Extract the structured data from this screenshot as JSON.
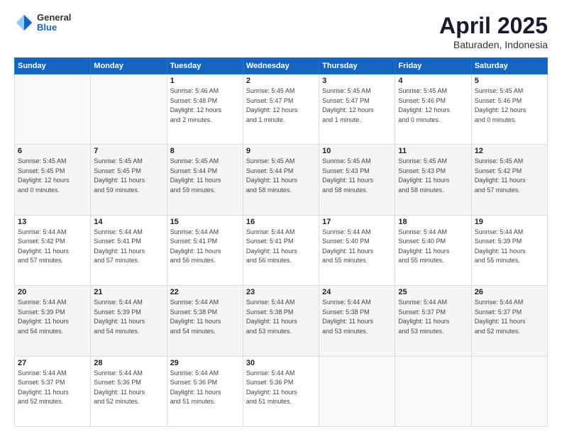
{
  "header": {
    "logo": {
      "line1": "General",
      "line2": "Blue"
    },
    "title": "April 2025",
    "location": "Baturaden, Indonesia"
  },
  "days_of_week": [
    "Sunday",
    "Monday",
    "Tuesday",
    "Wednesday",
    "Thursday",
    "Friday",
    "Saturday"
  ],
  "weeks": [
    [
      {
        "day": "",
        "info": ""
      },
      {
        "day": "",
        "info": ""
      },
      {
        "day": "1",
        "info": "Sunrise: 5:46 AM\nSunset: 5:48 PM\nDaylight: 12 hours\nand 2 minutes."
      },
      {
        "day": "2",
        "info": "Sunrise: 5:45 AM\nSunset: 5:47 PM\nDaylight: 12 hours\nand 1 minute."
      },
      {
        "day": "3",
        "info": "Sunrise: 5:45 AM\nSunset: 5:47 PM\nDaylight: 12 hours\nand 1 minute."
      },
      {
        "day": "4",
        "info": "Sunrise: 5:45 AM\nSunset: 5:46 PM\nDaylight: 12 hours\nand 0 minutes."
      },
      {
        "day": "5",
        "info": "Sunrise: 5:45 AM\nSunset: 5:46 PM\nDaylight: 12 hours\nand 0 minutes."
      }
    ],
    [
      {
        "day": "6",
        "info": "Sunrise: 5:45 AM\nSunset: 5:45 PM\nDaylight: 12 hours\nand 0 minutes."
      },
      {
        "day": "7",
        "info": "Sunrise: 5:45 AM\nSunset: 5:45 PM\nDaylight: 11 hours\nand 59 minutes."
      },
      {
        "day": "8",
        "info": "Sunrise: 5:45 AM\nSunset: 5:44 PM\nDaylight: 11 hours\nand 59 minutes."
      },
      {
        "day": "9",
        "info": "Sunrise: 5:45 AM\nSunset: 5:44 PM\nDaylight: 11 hours\nand 58 minutes."
      },
      {
        "day": "10",
        "info": "Sunrise: 5:45 AM\nSunset: 5:43 PM\nDaylight: 11 hours\nand 58 minutes."
      },
      {
        "day": "11",
        "info": "Sunrise: 5:45 AM\nSunset: 5:43 PM\nDaylight: 11 hours\nand 58 minutes."
      },
      {
        "day": "12",
        "info": "Sunrise: 5:45 AM\nSunset: 5:42 PM\nDaylight: 11 hours\nand 57 minutes."
      }
    ],
    [
      {
        "day": "13",
        "info": "Sunrise: 5:44 AM\nSunset: 5:42 PM\nDaylight: 11 hours\nand 57 minutes."
      },
      {
        "day": "14",
        "info": "Sunrise: 5:44 AM\nSunset: 5:41 PM\nDaylight: 11 hours\nand 57 minutes."
      },
      {
        "day": "15",
        "info": "Sunrise: 5:44 AM\nSunset: 5:41 PM\nDaylight: 11 hours\nand 56 minutes."
      },
      {
        "day": "16",
        "info": "Sunrise: 5:44 AM\nSunset: 5:41 PM\nDaylight: 11 hours\nand 56 minutes."
      },
      {
        "day": "17",
        "info": "Sunrise: 5:44 AM\nSunset: 5:40 PM\nDaylight: 11 hours\nand 55 minutes."
      },
      {
        "day": "18",
        "info": "Sunrise: 5:44 AM\nSunset: 5:40 PM\nDaylight: 11 hours\nand 55 minutes."
      },
      {
        "day": "19",
        "info": "Sunrise: 5:44 AM\nSunset: 5:39 PM\nDaylight: 11 hours\nand 55 minutes."
      }
    ],
    [
      {
        "day": "20",
        "info": "Sunrise: 5:44 AM\nSunset: 5:39 PM\nDaylight: 11 hours\nand 54 minutes."
      },
      {
        "day": "21",
        "info": "Sunrise: 5:44 AM\nSunset: 5:39 PM\nDaylight: 11 hours\nand 54 minutes."
      },
      {
        "day": "22",
        "info": "Sunrise: 5:44 AM\nSunset: 5:38 PM\nDaylight: 11 hours\nand 54 minutes."
      },
      {
        "day": "23",
        "info": "Sunrise: 5:44 AM\nSunset: 5:38 PM\nDaylight: 11 hours\nand 53 minutes."
      },
      {
        "day": "24",
        "info": "Sunrise: 5:44 AM\nSunset: 5:38 PM\nDaylight: 11 hours\nand 53 minutes."
      },
      {
        "day": "25",
        "info": "Sunrise: 5:44 AM\nSunset: 5:37 PM\nDaylight: 11 hours\nand 53 minutes."
      },
      {
        "day": "26",
        "info": "Sunrise: 5:44 AM\nSunset: 5:37 PM\nDaylight: 11 hours\nand 52 minutes."
      }
    ],
    [
      {
        "day": "27",
        "info": "Sunrise: 5:44 AM\nSunset: 5:37 PM\nDaylight: 11 hours\nand 52 minutes."
      },
      {
        "day": "28",
        "info": "Sunrise: 5:44 AM\nSunset: 5:36 PM\nDaylight: 11 hours\nand 52 minutes."
      },
      {
        "day": "29",
        "info": "Sunrise: 5:44 AM\nSunset: 5:36 PM\nDaylight: 11 hours\nand 51 minutes."
      },
      {
        "day": "30",
        "info": "Sunrise: 5:44 AM\nSunset: 5:36 PM\nDaylight: 11 hours\nand 51 minutes."
      },
      {
        "day": "",
        "info": ""
      },
      {
        "day": "",
        "info": ""
      },
      {
        "day": "",
        "info": ""
      }
    ]
  ]
}
